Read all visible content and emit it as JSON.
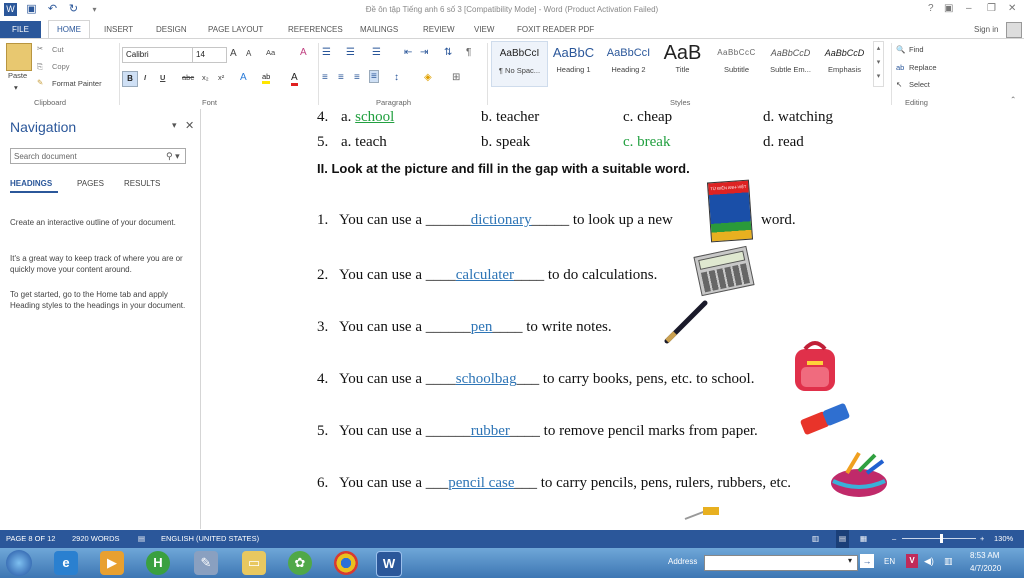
{
  "window": {
    "title": "Đề ôn tập Tiếng anh 6 số 3 [Compatibility Mode] - Word (Product Activation Failed)",
    "sign_in": "Sign in",
    "help": "?"
  },
  "tabs": [
    "FILE",
    "HOME",
    "INSERT",
    "DESIGN",
    "PAGE LAYOUT",
    "REFERENCES",
    "MAILINGS",
    "REVIEW",
    "VIEW",
    "FOXIT READER PDF"
  ],
  "ribbon": {
    "clipboard": {
      "label": "Clipboard",
      "paste": "Paste",
      "cut": "Cut",
      "copy": "Copy",
      "format_painter": "Format Painter"
    },
    "font": {
      "label": "Font",
      "name": "Calibri",
      "size": "14",
      "grow": "A",
      "shrink": "A",
      "case": "Aa"
    },
    "paragraph": {
      "label": "Paragraph"
    },
    "styles": {
      "label": "Styles",
      "items": [
        {
          "sample": "AaBbCcI",
          "name": "¶ No Spac..."
        },
        {
          "sample": "AaBbC",
          "name": "Heading 1"
        },
        {
          "sample": "AaBbCcI",
          "name": "Heading 2"
        },
        {
          "sample": "AaB",
          "name": "Title"
        },
        {
          "sample": "AaBbCcC",
          "name": "Subtitle"
        },
        {
          "sample": "AaBbCcD",
          "name": "Subtle Em..."
        },
        {
          "sample": "AaBbCcD",
          "name": "Emphasis"
        }
      ]
    },
    "editing": {
      "label": "Editing",
      "find": "Find",
      "replace": "Replace",
      "select": "Select"
    }
  },
  "nav": {
    "title": "Navigation",
    "search_placeholder": "Search document",
    "tabs": [
      "HEADINGS",
      "PAGES",
      "RESULTS"
    ],
    "text1": "Create an interactive outline of your document.",
    "text2": "It's a great way to keep track of where you are or quickly move your content around.",
    "text3": "To get started, go to the Home tab and apply Heading styles to the headings in your document."
  },
  "document": {
    "row4": {
      "num": "4.",
      "a": "a. ",
      "a_ans": "school",
      "b": "b. teacher",
      "c": "c. cheap",
      "d": "d. watching"
    },
    "row5": {
      "num": "5.",
      "a": "a. teach",
      "b": "b. speak",
      "c": "c. break",
      "d": "d. read"
    },
    "section2": "II.   Look at the picture and fill in the gap with a suitable word.",
    "items": [
      {
        "num": "1.",
        "pre": "You can use a ______",
        "ans": "dictionary",
        "post": "_____ to look up a new",
        "tail": "word."
      },
      {
        "num": "2.",
        "pre": "You can use a ____",
        "ans": "calculater",
        "post": "____ to do calculations.",
        "tail": ""
      },
      {
        "num": "3.",
        "pre": "You can use a ______",
        "ans": "pen",
        "post": "____ to write notes.",
        "tail": ""
      },
      {
        "num": "4.",
        "pre": "You can use a ____",
        "ans": "schoolbag",
        "post": "___ to carry books, pens, etc. to school.",
        "tail": ""
      },
      {
        "num": "5.",
        "pre": "You can use a ______",
        "ans": "rubber",
        "post": "____ to remove pencil marks from paper.",
        "tail": ""
      },
      {
        "num": "6.",
        "pre": "You can use a ___",
        "ans": "pencil case",
        "post": "___ to carry pencils, pens, rulers, rubbers, etc.",
        "tail": ""
      }
    ],
    "dict_cover": "TỪ ĐIỂN ANH-VIỆT"
  },
  "status": {
    "page": "PAGE 8 OF 12",
    "words": "2920 WORDS",
    "lang": "ENGLISH (UNITED STATES)",
    "zoom": "130%"
  },
  "taskbar": {
    "address": "Address",
    "lang": "EN",
    "time": "8:53 AM",
    "date": "4/7/2020"
  }
}
